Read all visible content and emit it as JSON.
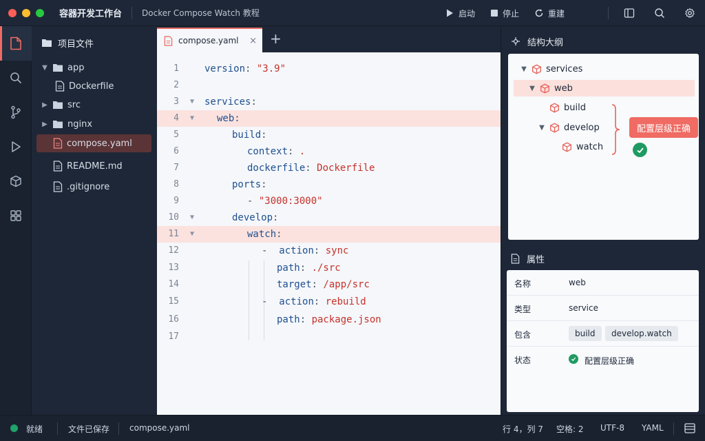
{
  "window": {
    "app_title": "容器开发工作台",
    "doc_title": "Docker Compose Watch 教程",
    "actions": [
      {
        "label": "启动",
        "icon": "play-icon"
      },
      {
        "label": "停止",
        "icon": "stop-icon"
      },
      {
        "label": "重建",
        "icon": "refresh-icon"
      }
    ],
    "right_icons": [
      "panel-layout-icon",
      "search-icon",
      "gear-icon"
    ]
  },
  "activity_bar": [
    "file-icon",
    "search-icon",
    "git-branch-icon",
    "run-icon",
    "cube-icon",
    "grid-icon"
  ],
  "explorer": {
    "title": "项目文件",
    "items": [
      {
        "label": "app",
        "type": "folder",
        "expanded": true
      },
      {
        "label": "Dockerfile",
        "type": "file"
      },
      {
        "label": "src",
        "type": "folder",
        "expanded": false
      },
      {
        "label": "nginx",
        "type": "folder",
        "expanded": false
      },
      {
        "label": "compose.yaml",
        "type": "file",
        "selected": true
      },
      {
        "label": "README.md",
        "type": "file"
      },
      {
        "label": ".gitignore",
        "type": "file"
      }
    ]
  },
  "editor": {
    "tab_label": "compose.yaml",
    "tab_close": "×",
    "tab_add": "+",
    "lines": [
      {
        "n": "1",
        "text": "version: \"3.9\""
      },
      {
        "n": "2",
        "text": ""
      },
      {
        "n": "3",
        "text": "services:"
      },
      {
        "n": "4",
        "text": "  web:"
      },
      {
        "n": "5",
        "text": "    build:"
      },
      {
        "n": "6",
        "text": "      context: ."
      },
      {
        "n": "7",
        "text": "      dockerfile: Dockerfile"
      },
      {
        "n": "8",
        "text": "    ports:"
      },
      {
        "n": "9",
        "text": "      - \"3000:3000\""
      },
      {
        "n": "10",
        "text": "    develop:"
      },
      {
        "n": "11",
        "text": "      watch:"
      },
      {
        "n": "12",
        "text": "        - action: sync"
      },
      {
        "n": "13",
        "text": "          path: ./src"
      },
      {
        "n": "14",
        "text": "          target: /app/src"
      },
      {
        "n": "15",
        "text": "        - action: rebuild"
      },
      {
        "n": "16",
        "text": "          path: package.json"
      },
      {
        "n": "17",
        "text": ""
      }
    ]
  },
  "outline": {
    "title": "结构大纲",
    "nodes": [
      {
        "label": "services"
      },
      {
        "label": "web",
        "selected": true
      },
      {
        "label": "build"
      },
      {
        "label": "develop"
      },
      {
        "label": "watch"
      }
    ],
    "callout": "配置层级正确"
  },
  "properties": {
    "title": "属性",
    "rows": [
      {
        "key": "名称",
        "value": "web"
      },
      {
        "key": "类型",
        "value": "service"
      },
      {
        "key": "包含",
        "chips": [
          "build",
          "develop.watch"
        ]
      },
      {
        "key": "状态",
        "value": "配置层级正确"
      }
    ]
  },
  "status_bar": {
    "ready": "就绪",
    "saved": "文件已保存",
    "file": "compose.yaml",
    "cursor": "行 4，列 7",
    "indent": "空格: 2",
    "encoding": "UTF-8",
    "language": "YAML"
  },
  "colors": {
    "accent": "#ef6b63",
    "success": "#1f9b62",
    "chrome": "#1e2737",
    "editor_bg": "#f5f7fa"
  }
}
